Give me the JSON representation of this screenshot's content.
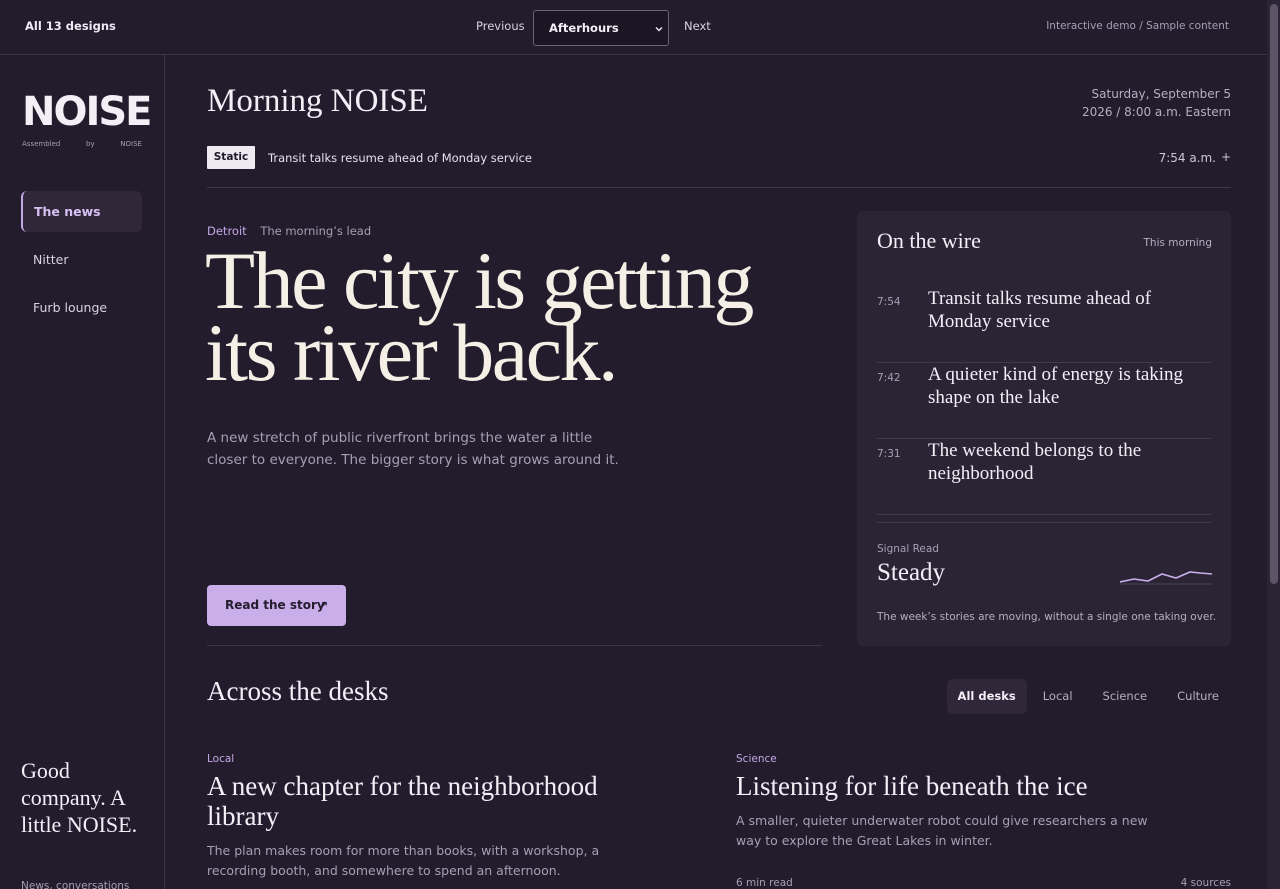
{
  "topbar": {
    "all_designs": "All 13 designs",
    "previous": "Previous",
    "design_selected": "Afterhours",
    "next": "Next",
    "demo_note": "Interactive demo / Sample content"
  },
  "sidebar": {
    "logo": "NOISE",
    "logo_sub": [
      "Assembled",
      "by",
      "NOISE"
    ],
    "nav": [
      {
        "label": "The news",
        "active": true
      },
      {
        "label": "Nitter",
        "active": false
      },
      {
        "label": "Furb lounge",
        "active": false
      }
    ],
    "tagline": "Good company. A little NOISE.",
    "tagline_sub": "News, conversations"
  },
  "header": {
    "title": "Morning NOISE",
    "date_line1": "Saturday, September 5",
    "date_line2": "2026 / 8:00 a.m. Eastern",
    "ticker_badge": "Static",
    "ticker_text": "Transit talks resume ahead of Monday service",
    "ticker_time": "7:54 a.m.",
    "ticker_plus": "+"
  },
  "lead": {
    "location": "Detroit",
    "label": "The morning’s lead",
    "headline": "The city is getting its river back.",
    "dek": "A new stretch of public riverfront brings the water a little closer to everyone. The bigger story is what grows around it.",
    "button": "Read the story",
    "button_arrow": "↗"
  },
  "wire": {
    "title": "On the wire",
    "when": "This morning",
    "items": [
      {
        "time": "7:54",
        "headline": "Transit talks resume ahead of Monday service"
      },
      {
        "time": "7:42",
        "headline": "A quieter kind of energy is taking shape on the lake"
      },
      {
        "time": "7:31",
        "headline": "The weekend belongs to the neighborhood"
      }
    ],
    "signal_label": "Signal Read",
    "signal_value": "Steady",
    "signal_note": "The week’s stories are moving, without a single one taking over.",
    "spark_color": "#c9aee9"
  },
  "desks": {
    "title": "Across the desks",
    "tabs": [
      {
        "label": "All desks",
        "active": true
      },
      {
        "label": "Local",
        "active": false
      },
      {
        "label": "Science",
        "active": false
      },
      {
        "label": "Culture",
        "active": false
      }
    ],
    "cards": [
      {
        "section": "Local",
        "title": "A new chapter for the neighborhood library",
        "summary": "The plan makes room for more than books, with a workshop, a recording booth, and somewhere to spend an afternoon."
      },
      {
        "section": "Science",
        "title": "Listening for life beneath the ice",
        "summary": "A smaller, quieter underwater robot could give researchers a new way to explore the Great Lakes in winter.",
        "read_time": "6 min read",
        "sources": "4 sources"
      }
    ]
  },
  "colors": {
    "background": "#221c2d",
    "panel": "#2b2435",
    "accent": "#c9aee9",
    "headline": "#f5efe6"
  }
}
